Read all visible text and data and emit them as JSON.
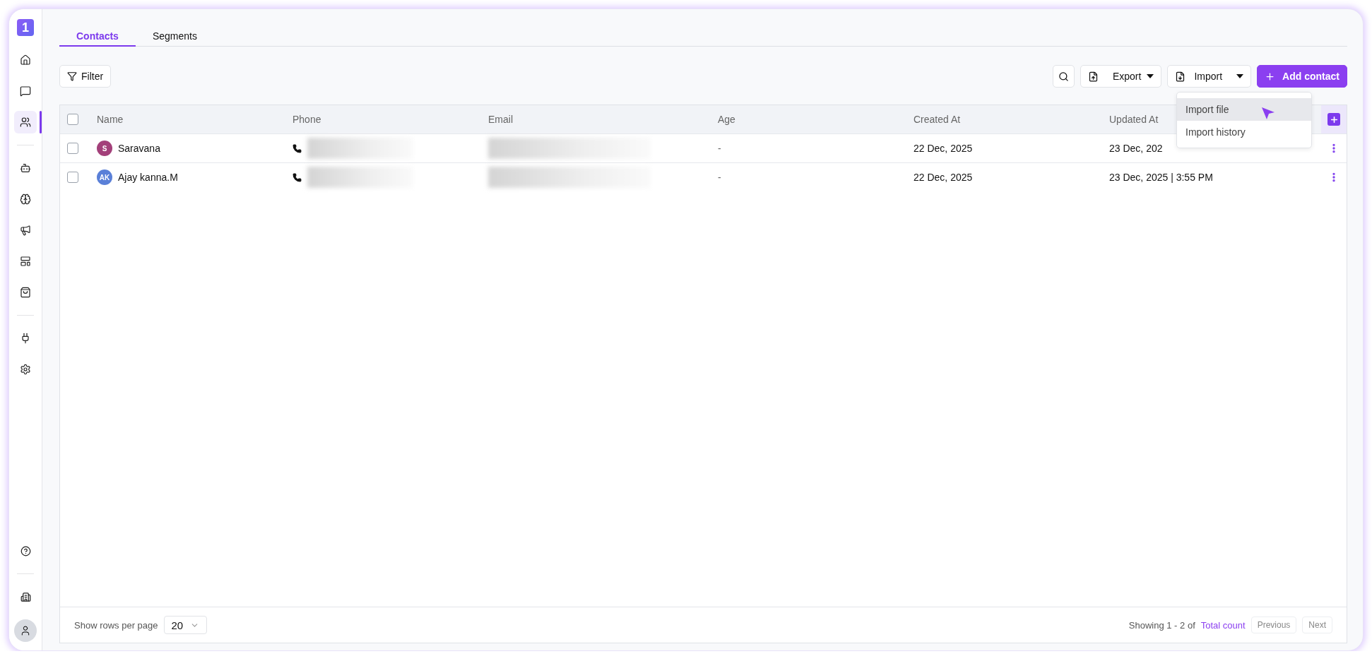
{
  "sidebar": {
    "logo": "1",
    "sections": [
      [
        {
          "selected": false
        },
        {
          "selected": false
        },
        {
          "selected": true
        }
      ],
      [
        {
          "selected": false
        },
        {
          "selected": false
        },
        {
          "selected": false
        },
        {
          "selected": false
        },
        {
          "selected": false
        }
      ],
      [
        {
          "selected": false
        },
        {
          "selected": false
        }
      ]
    ]
  },
  "tabs": [
    {
      "label": "Contacts",
      "selected": true
    },
    {
      "label": "Segments",
      "selected": false
    }
  ],
  "toolbar": {
    "filter": "Filter",
    "export": "Export",
    "import": "Import",
    "add": "Add contact"
  },
  "import_menu": {
    "items": [
      {
        "label": "Import file",
        "selected": true
      },
      {
        "label": "Import history",
        "selected": false
      }
    ]
  },
  "table": {
    "select_all_checked": false,
    "columns": [
      "Name",
      "Phone",
      "Email",
      "Age",
      "Created At",
      "Updated At"
    ],
    "rows": [
      {
        "checked": false,
        "initials": "S",
        "color": "#a3407a",
        "name": "Saravana",
        "age": "-",
        "created_at": "22 Dec, 2025",
        "updated_at": "23 Dec, 202"
      },
      {
        "checked": false,
        "initials": "AK",
        "color": "#5a80d8",
        "name": "Ajay kanna.M",
        "age": "-",
        "created_at": "22 Dec, 2025",
        "updated_at": "23 Dec, 2025 | 3:55 PM"
      }
    ]
  },
  "footer": {
    "rows_label": "Show rows per page",
    "rows_per_page": "20",
    "showing": "Showing 1 - 2 of",
    "total": "Total count",
    "previous": "Previous",
    "next": "Next"
  }
}
